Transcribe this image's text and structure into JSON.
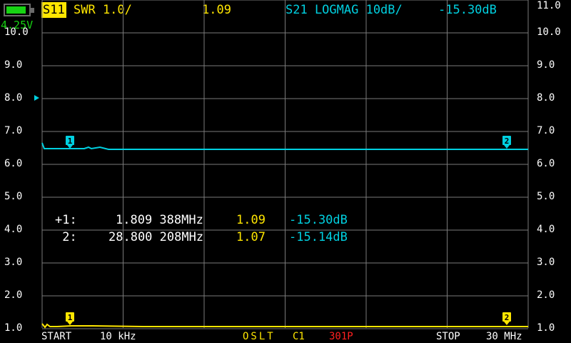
{
  "status": {
    "battery_voltage": "4.25V",
    "battery_level": 0.85,
    "battery_color": "#17d313"
  },
  "header": {
    "ch1_label": "S11",
    "ch1_format": "SWR 1.0/",
    "ch1_value": "1.09",
    "ch2_format": "S21 LOGMAG 10dB/",
    "ch2_value": "-15.30dB"
  },
  "axis": {
    "left_ticks": [
      "10.0",
      "9.0",
      "8.0",
      "7.0",
      "6.0",
      "5.0",
      "4.0",
      "3.0",
      "2.0",
      "1.0"
    ],
    "right_ticks": [
      "11.0",
      "10.0",
      "9.0",
      "8.0",
      "7.0",
      "6.0",
      "5.0",
      "4.0",
      "3.0",
      "2.0",
      "1.0"
    ]
  },
  "markers": [
    {
      "id": "1",
      "prefix": "+1:",
      "freq": "1.809 388MHz",
      "swr": "1.09",
      "logmag": "-15.30dB"
    },
    {
      "id": "2",
      "prefix": " 2:",
      "freq": "28.800 208MHz",
      "swr": "1.07",
      "logmag": "-15.14dB"
    }
  ],
  "footer": {
    "start_label": "START",
    "start_value": "10 kHz",
    "cal_label": "OSLT",
    "cal_channel": "C1",
    "points": "301P",
    "stop_label": "STOP",
    "stop_value": "30 MHz"
  },
  "colors": {
    "trace_swr": "#ffe600",
    "trace_s21": "#00d0e0",
    "grid": "#7a7a7a",
    "points": "#ff2020"
  },
  "chart_data": {
    "type": "line",
    "x_range_mhz": [
      0.01,
      30
    ],
    "swr_axis": [
      1,
      11
    ],
    "series": [
      {
        "values_swr": [
          1.09,
          1.08,
          1.07,
          1.07,
          1.08,
          1.08,
          1.07,
          1.07,
          1.07
        ]
      },
      {
        "values_db": [
          -15.3,
          -15.28,
          -15.25,
          -15.2,
          -15.18,
          -15.17,
          -15.15,
          -15.14,
          -15.14
        ]
      }
    ]
  }
}
